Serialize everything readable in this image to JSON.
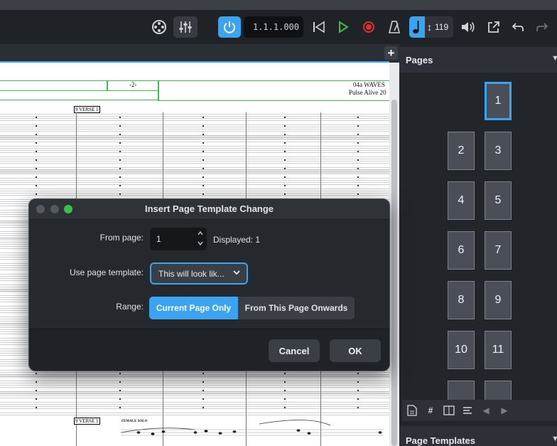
{
  "toolbar": {
    "position": "1.1.1.000",
    "tempo": "119",
    "icons": [
      "video-icon",
      "mixer-icon",
      "power-icon",
      "rewind-icon",
      "play-icon",
      "record-icon",
      "metronome-icon",
      "volume-icon",
      "export-icon",
      "undo-icon",
      "redo-icon"
    ]
  },
  "colors": {
    "accent": "#3aa3f2",
    "play": "#3fbf3f",
    "record": "#e0302c",
    "maximize": "#37c14b"
  },
  "score": {
    "page_number": "-2-",
    "title": "04a WAVES",
    "subtitle": "Pulse Alive 20",
    "rehearsal_1": "9 VERSE 1",
    "rehearsal_2": "9 VERSE 1",
    "solo_label": "FEMALE SOLO"
  },
  "pages_panel": {
    "title": "Pages",
    "thumbnails": [
      "1",
      "2",
      "3",
      "4",
      "5",
      "6",
      "7",
      "8",
      "9",
      "10",
      "11"
    ],
    "selected": "1"
  },
  "templates_panel": {
    "title": "Page Templates"
  },
  "dialog": {
    "title": "Insert Page Template Change",
    "from_page_label": "From page:",
    "from_page_value": "1",
    "displayed": "Displayed: 1",
    "template_label": "Use page template:",
    "template_value": "This will look lik...",
    "range_label": "Range:",
    "range_current": "Current Page Only",
    "range_onwards": "From This Page Onwards",
    "cancel": "Cancel",
    "ok": "OK"
  }
}
